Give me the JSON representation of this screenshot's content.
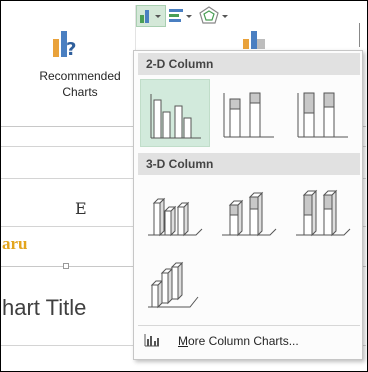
{
  "ribbon": {
    "recommended_charts_line1": "Recommended",
    "recommended_charts_line2": "Charts"
  },
  "sheet": {
    "column_header": "E",
    "cell_text": "aru",
    "chart_title": "hart Title"
  },
  "menu": {
    "section_2d": "2-D Column",
    "section_3d": "3-D Column",
    "more_charts_underlined": "M",
    "more_charts_rest": "ore Column Charts..."
  },
  "colors": {
    "selected_tile": "#d2eadc",
    "section_header": "#e1e1e1",
    "accent_green": "#4a9e55",
    "cell_text": "#e3a51d"
  }
}
